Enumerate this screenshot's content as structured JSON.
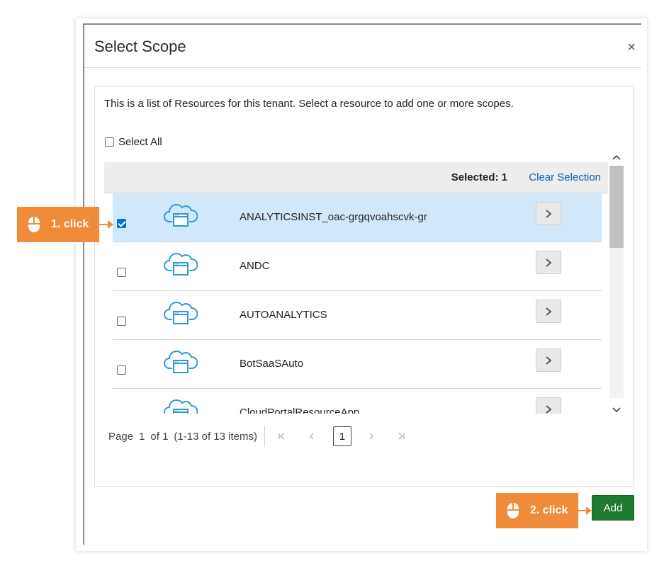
{
  "dialog": {
    "title": "Select Scope",
    "close_label": "×",
    "description": "This is a list of Resources for this tenant. Select a resource to add one or more scopes.",
    "select_all_label": "Select All",
    "selected_label": "Selected: 1",
    "clear_selection_label": "Clear Selection",
    "resources": [
      {
        "name": "ANALYTICSINST_oac-grgqvoahscvk-gr",
        "checked": true
      },
      {
        "name": "ANDC",
        "checked": false
      },
      {
        "name": "AUTOANALYTICS",
        "checked": false
      },
      {
        "name": "BotSaaSAuto",
        "checked": false
      },
      {
        "name": "CloudPortalResourceApp",
        "checked": false
      }
    ],
    "pager": {
      "page_label": "Page",
      "page_num": "1",
      "of_label": "of 1",
      "items_label": "(1-13 of 13 items)",
      "current_page": "1"
    },
    "add_label": "Add"
  },
  "callouts": {
    "first": "1. click",
    "second": "2. click"
  },
  "colors": {
    "accent_blue": "#0572ce",
    "selected_row": "#d1e7fa",
    "add_green": "#1e7a2e",
    "callout_orange": "#f08b3a",
    "link_blue": "#0b5ea8"
  },
  "icons": [
    "close-icon",
    "cloud-app-icon",
    "chevron-right-icon",
    "mouse-icon",
    "first-page-icon",
    "prev-page-icon",
    "next-page-icon",
    "last-page-icon",
    "scroll-up-icon",
    "scroll-down-icon"
  ]
}
